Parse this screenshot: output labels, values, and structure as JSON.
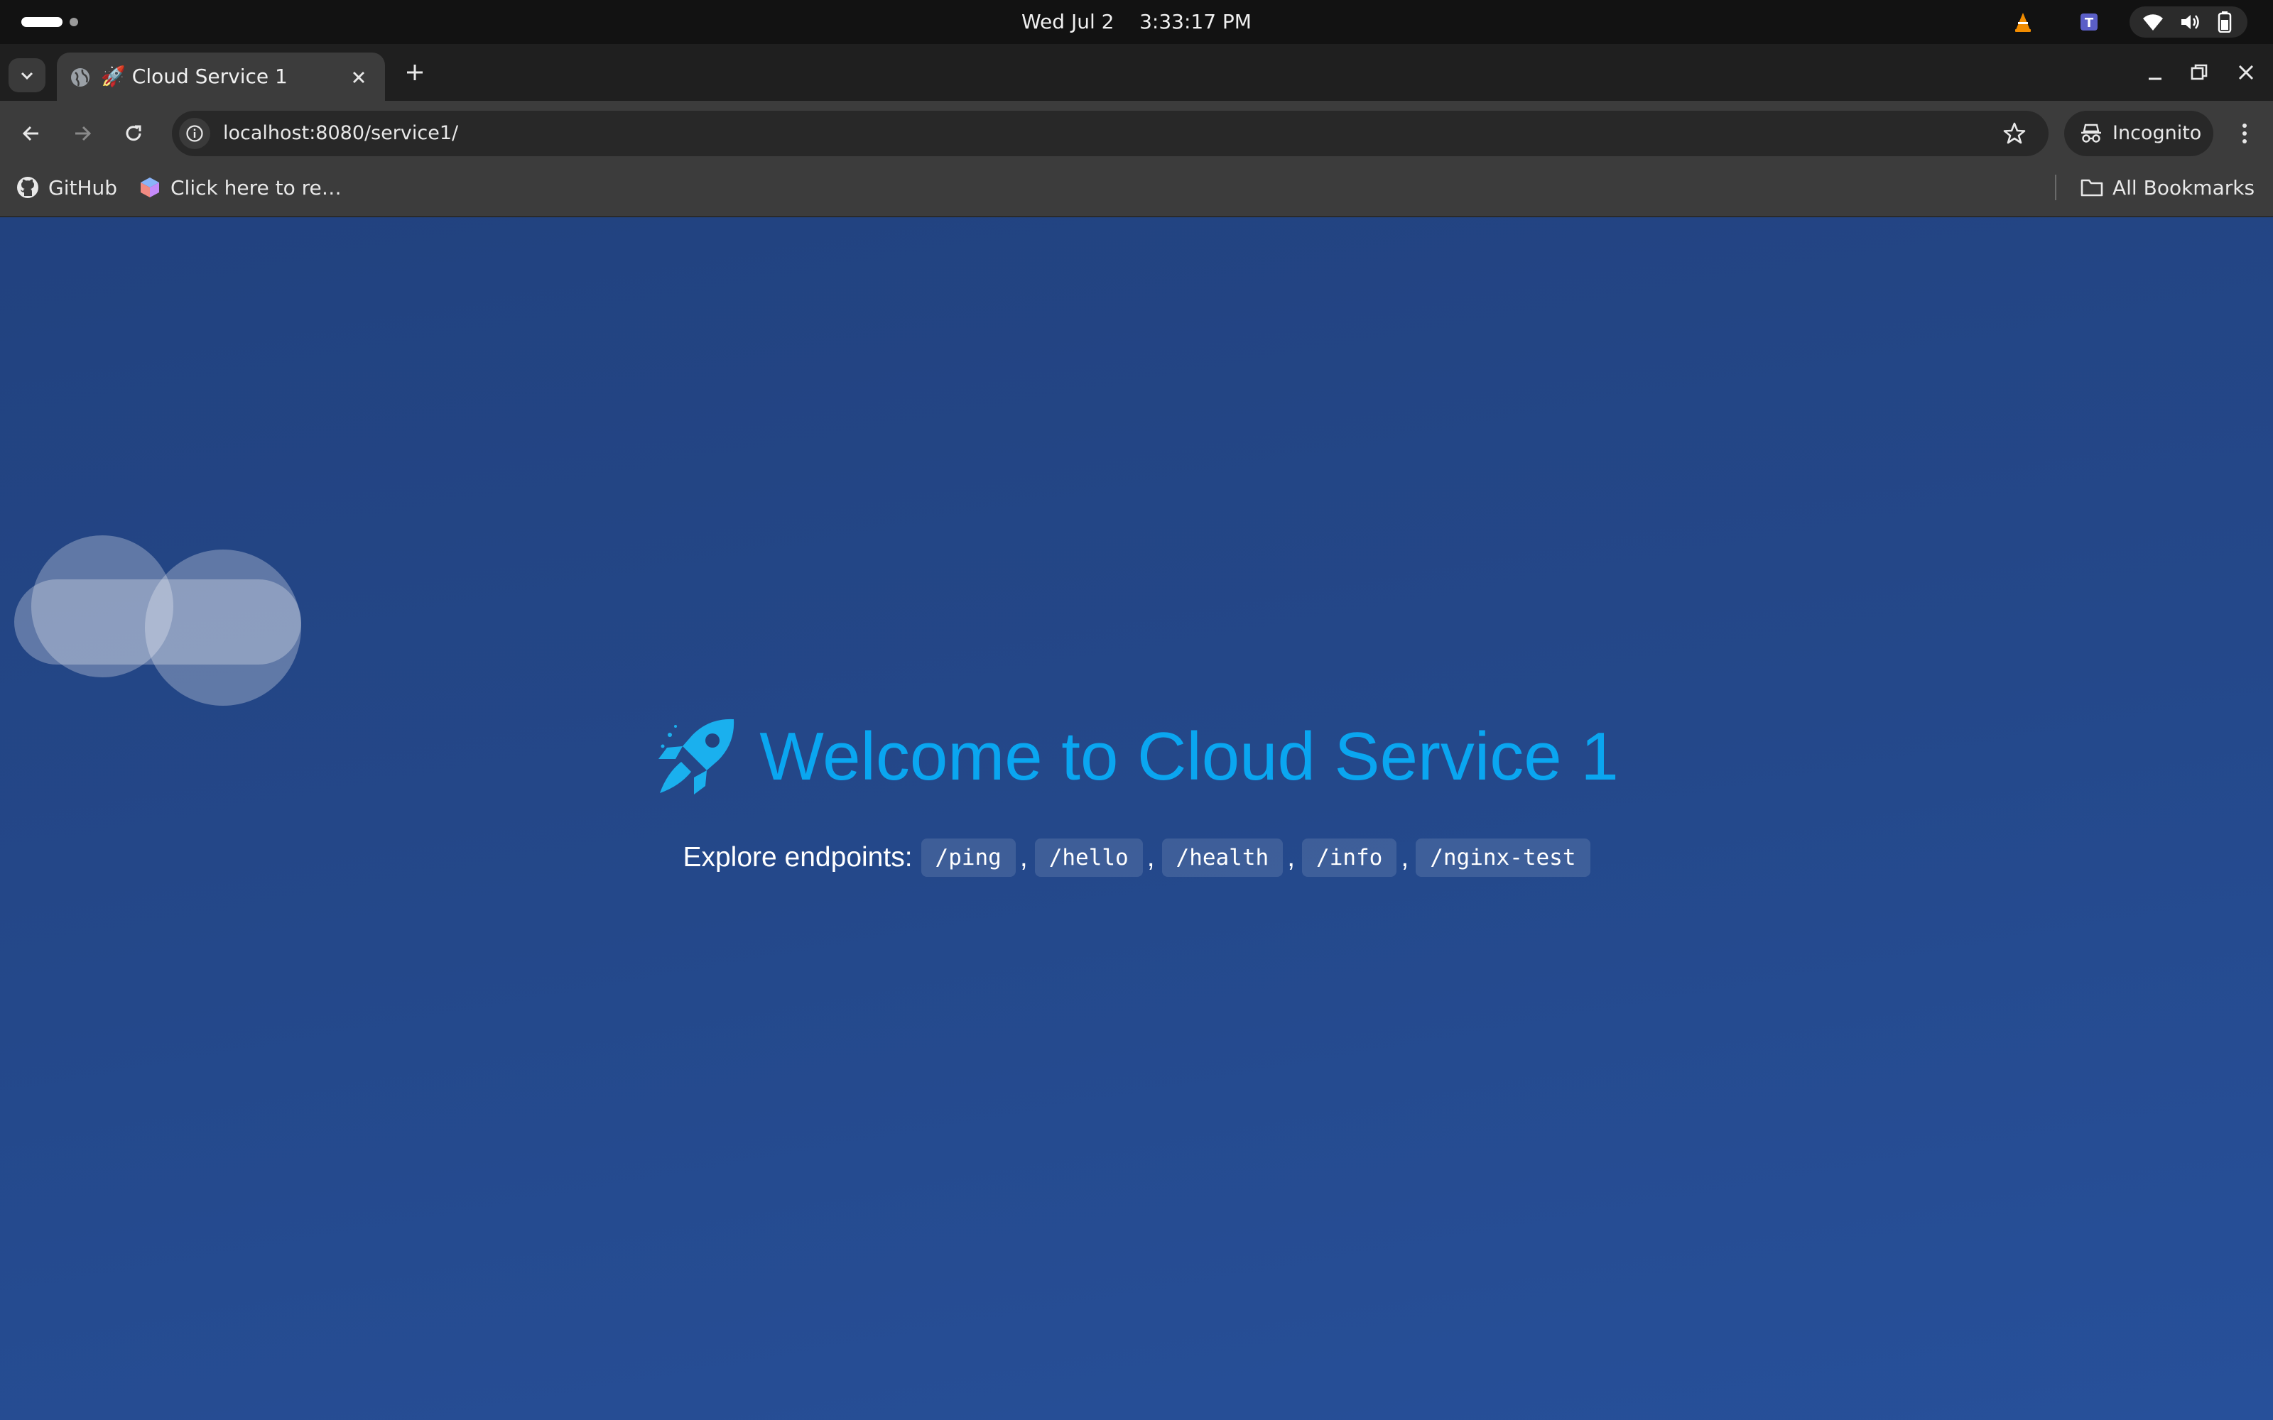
{
  "system_bar": {
    "date": "Wed Jul 2",
    "time": "3:33:17 PM"
  },
  "browser": {
    "tab": {
      "title": "🚀 Cloud Service 1"
    },
    "address_bar": {
      "url": "localhost:8080/service1/"
    },
    "incognito_label": "Incognito",
    "bookmarks": [
      {
        "label": "GitHub",
        "icon": "github-icon"
      },
      {
        "label": "Click here to re…",
        "icon": "cube-icon"
      }
    ],
    "all_bookmarks_label": "All Bookmarks"
  },
  "page": {
    "headline": "Welcome to Cloud Service 1",
    "headline_icon": "rocket-icon",
    "explore_label": "Explore endpoints:",
    "endpoints": [
      "/ping",
      "/hello",
      "/health",
      "/info",
      "/nginx-test"
    ],
    "colors": {
      "background": "#24488a",
      "headline": "#0aa6f0"
    }
  }
}
